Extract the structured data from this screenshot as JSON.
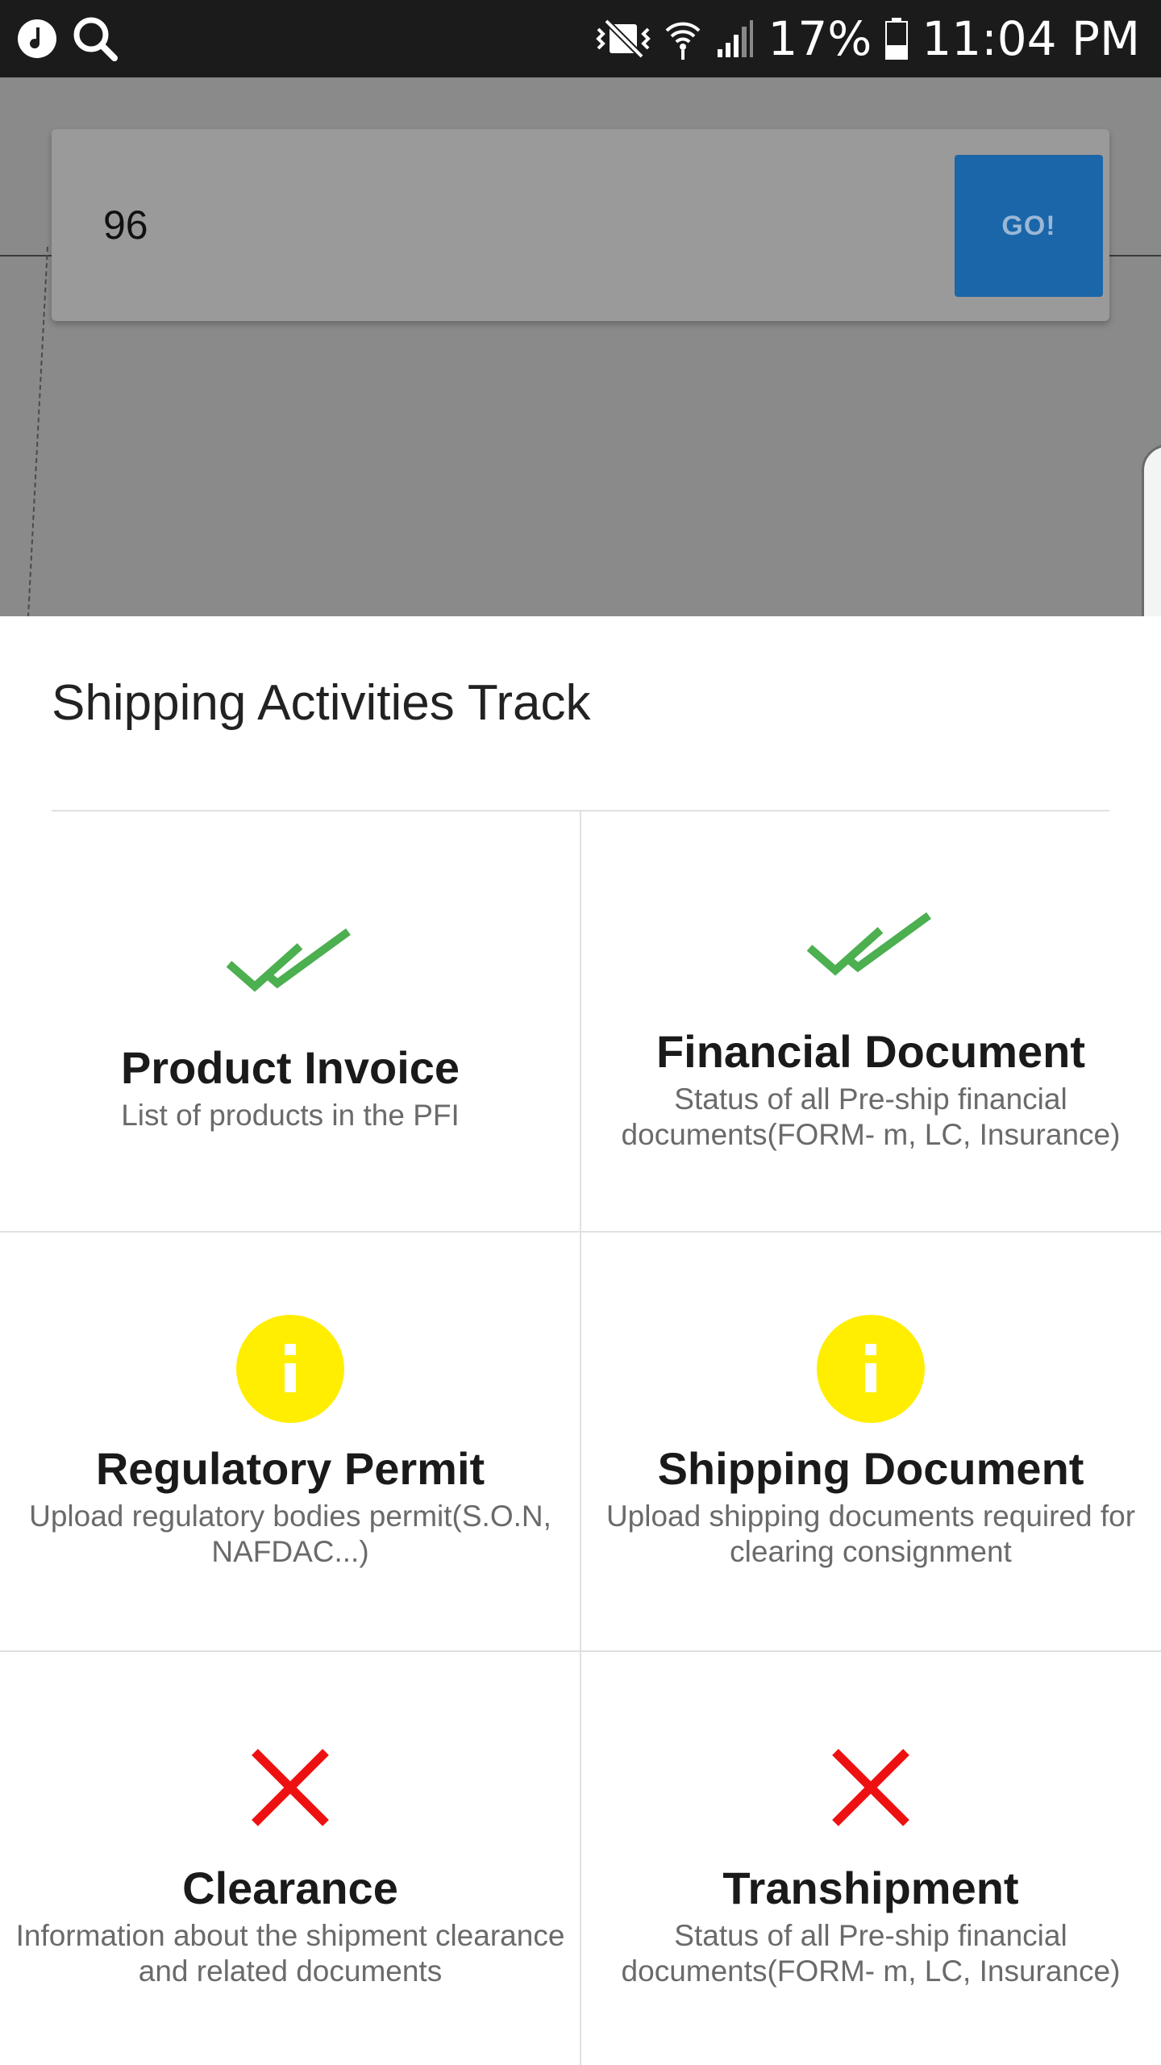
{
  "status_bar": {
    "battery": "17%",
    "time": "11:04 PM",
    "icons": [
      "music-note-icon",
      "search-icon",
      "mute-vibrate-icon",
      "wifi-icon",
      "signal-icon",
      "battery-icon"
    ]
  },
  "search": {
    "value": "96",
    "go_label": "GO!",
    "go_color": "#1a66a8"
  },
  "sheet": {
    "title": "Shipping Activities Track"
  },
  "activities": [
    {
      "title": "Product Invoice",
      "description": "List of products in the PFI",
      "status": "complete",
      "icon": "double-check-icon",
      "color": "#4caf50"
    },
    {
      "title": "Financial Document",
      "description": "Status of all Pre-ship financial documents(FORM- m, LC, Insurance)",
      "status": "complete",
      "icon": "double-check-icon",
      "color": "#4caf50"
    },
    {
      "title": "Regulatory Permit",
      "description": "Upload regulatory bodies permit(S.O.N, NAFDAC...)",
      "status": "pending",
      "icon": "info-icon",
      "color": "#ffee00"
    },
    {
      "title": "Shipping Document",
      "description": "Upload shipping documents required for clearing consignment",
      "status": "pending",
      "icon": "info-icon",
      "color": "#ffee00"
    },
    {
      "title": "Clearance",
      "description": "Information about the shipment clearance and related documents",
      "status": "incomplete",
      "icon": "cross-icon",
      "color": "#ee1111"
    },
    {
      "title": "Transhipment",
      "description": "Status of all Pre-ship financial documents(FORM- m, LC, Insurance)",
      "status": "incomplete",
      "icon": "cross-icon",
      "color": "#ee1111"
    }
  ]
}
